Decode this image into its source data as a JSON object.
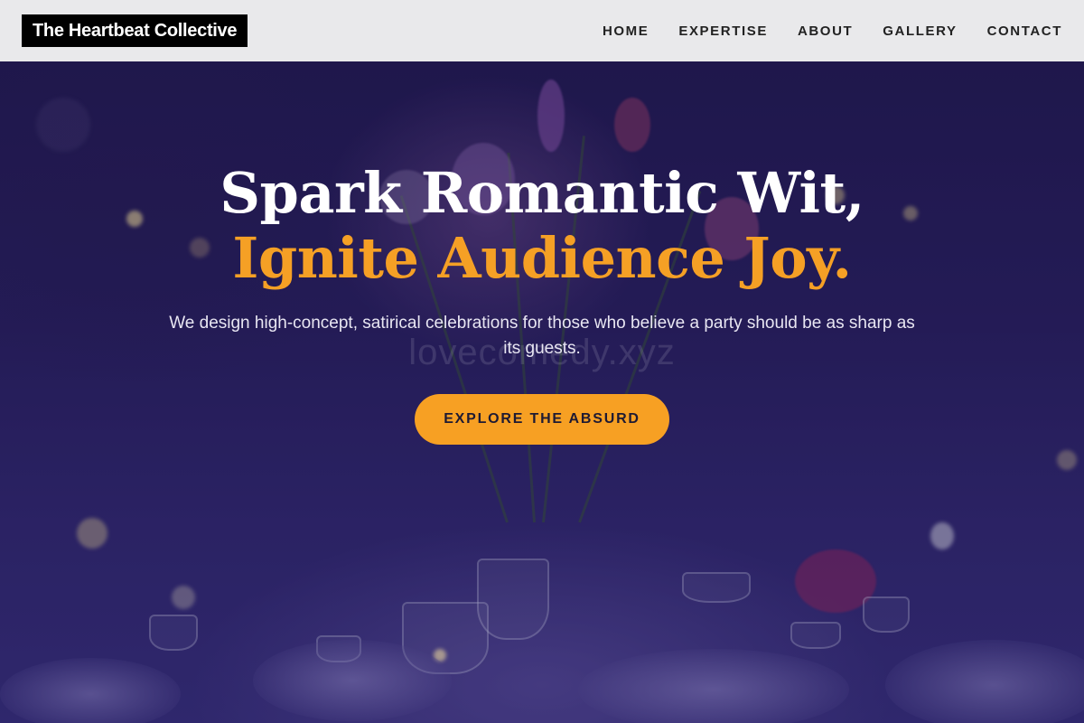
{
  "brand": {
    "logo_text": "The Heartbeat Collective"
  },
  "nav": {
    "items": [
      {
        "label": "HOME"
      },
      {
        "label": "EXPERTISE"
      },
      {
        "label": "ABOUT"
      },
      {
        "label": "GALLERY"
      },
      {
        "label": "CONTACT"
      }
    ]
  },
  "hero": {
    "headline_line1": "Spark Romantic Wit,",
    "headline_line2": "Ignite Audience Joy.",
    "watermark": "lovecomedy.xyz",
    "subtext": "We design high-concept, satirical celebrations for those who believe a party should be as sharp as its guests.",
    "cta_label": "EXPLORE THE ABSURD"
  },
  "colors": {
    "accent": "#f7a023",
    "nav_background": "#e9e9eb",
    "logo_background": "#000000",
    "hero_tint": "#2b2166"
  }
}
